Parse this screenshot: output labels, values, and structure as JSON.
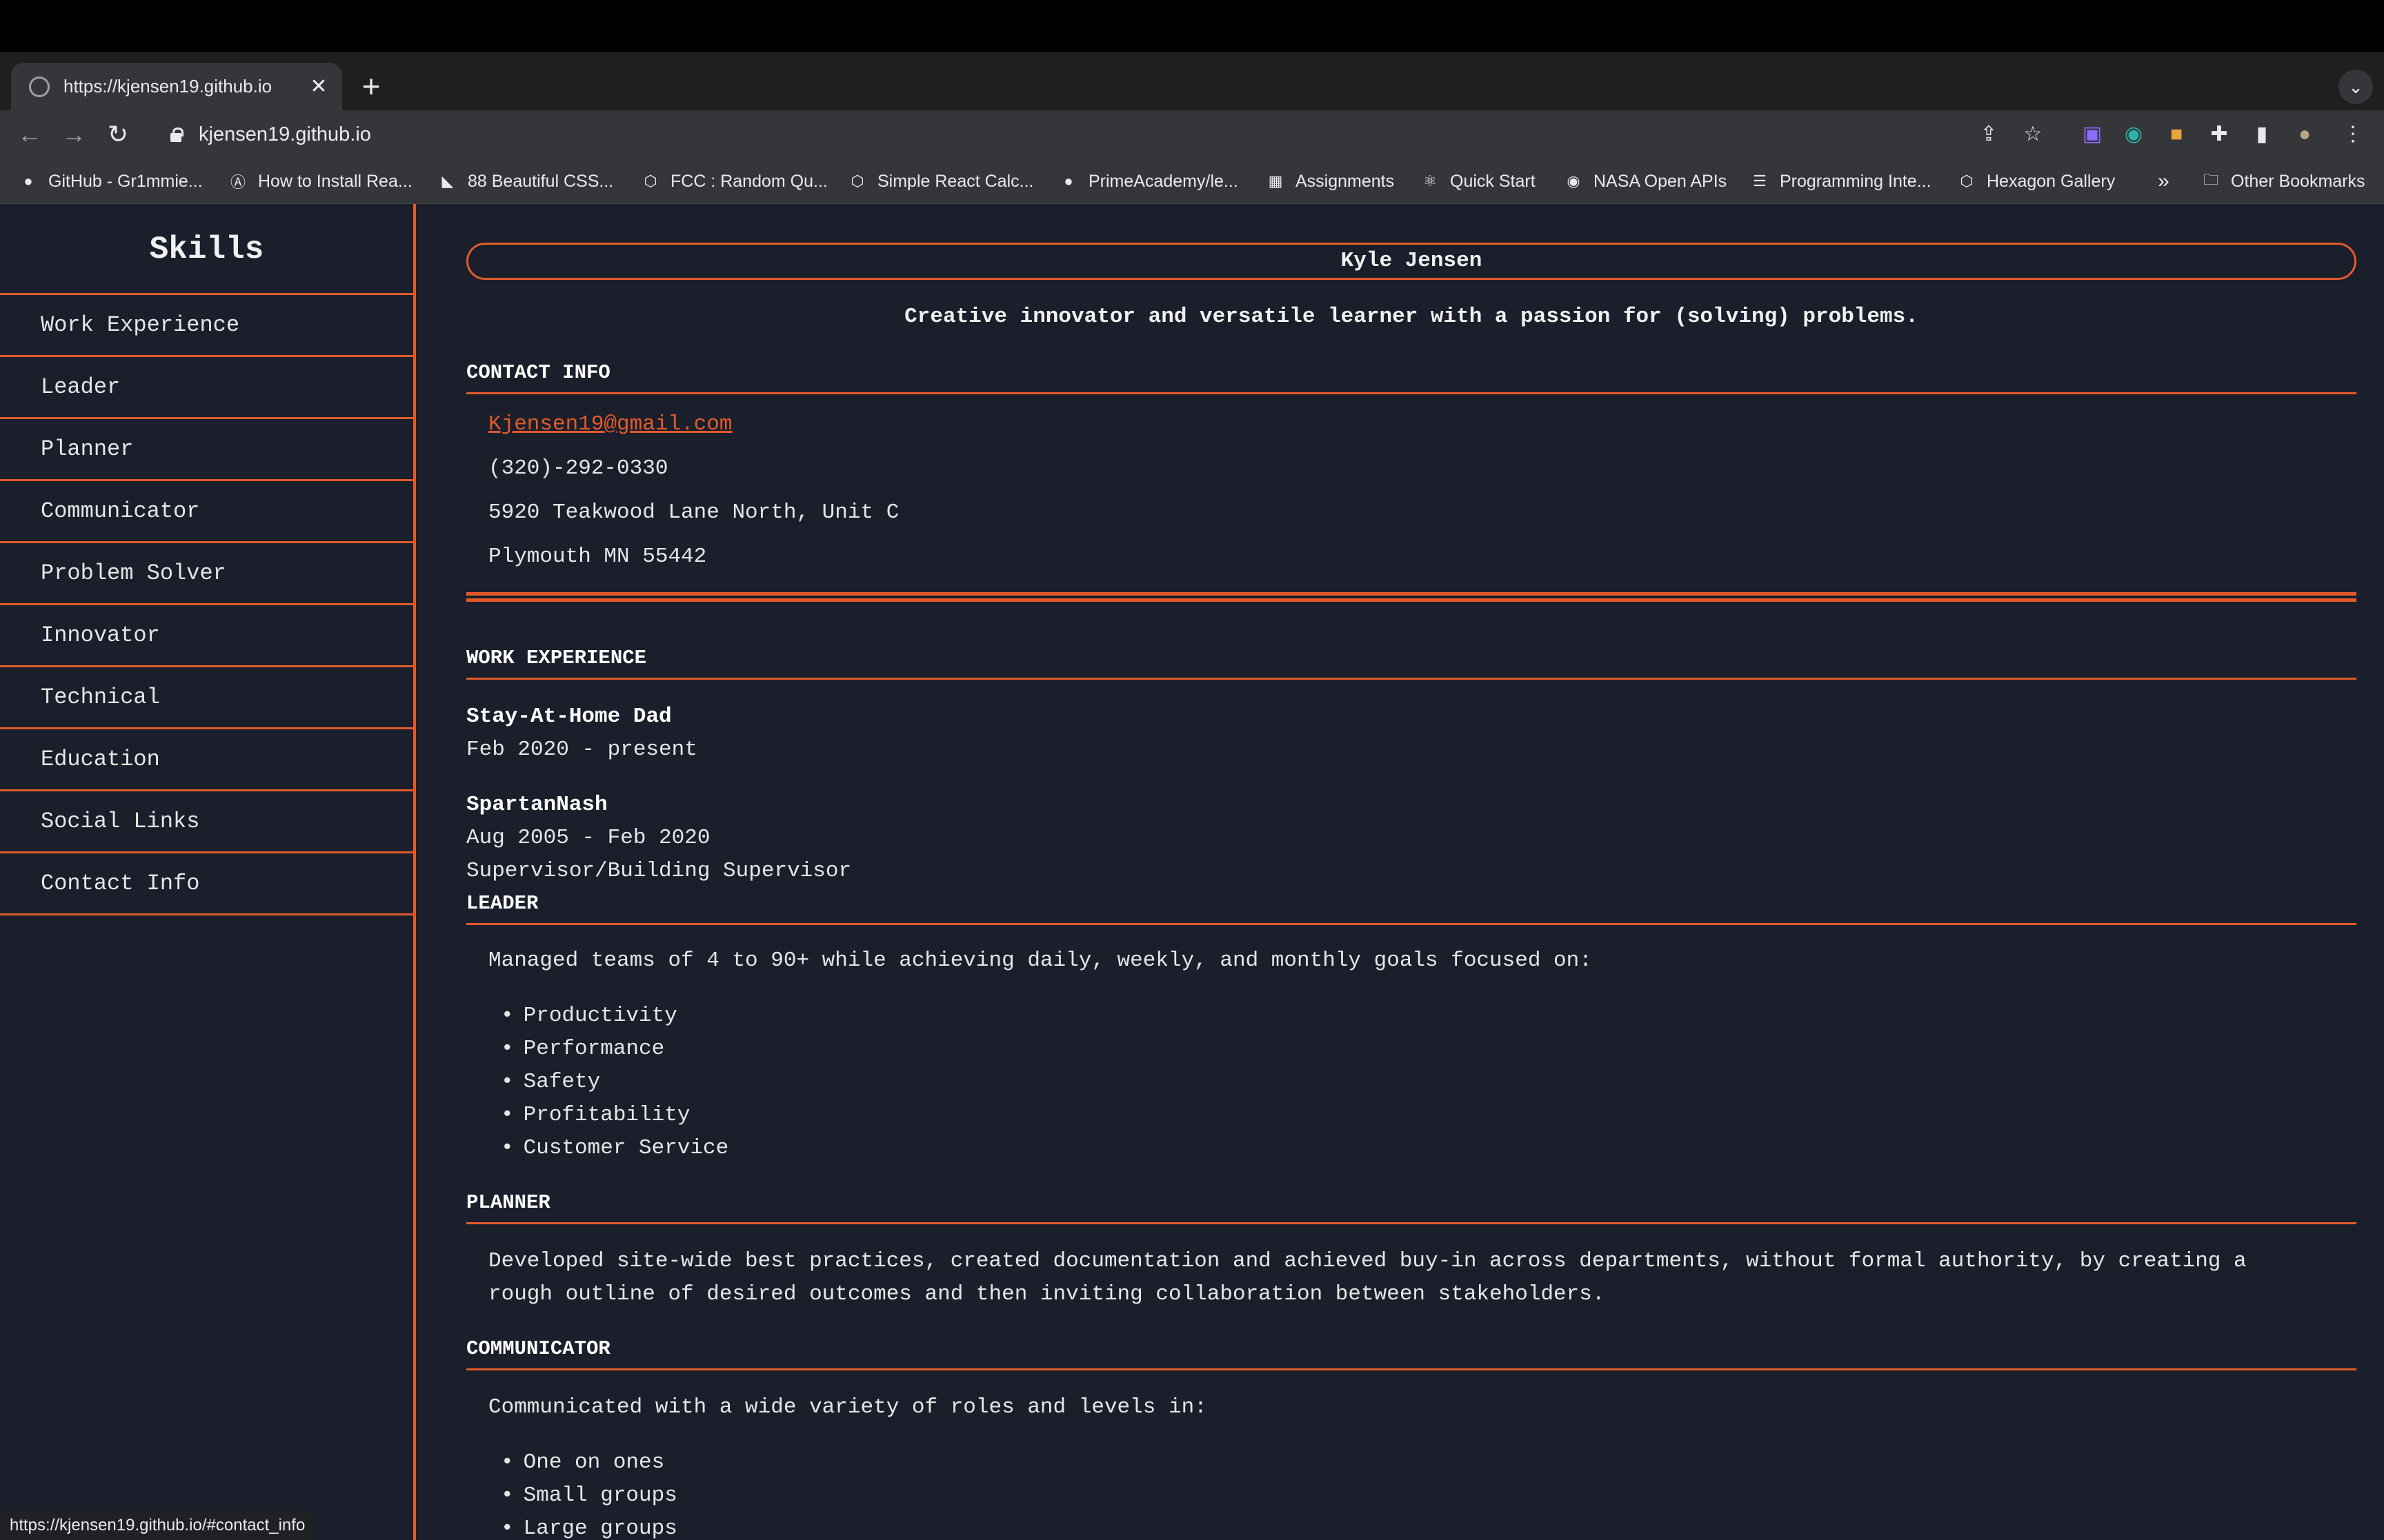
{
  "browser": {
    "tab_title": "https://kjensen19.github.io",
    "tab_close": "✕",
    "new_tab": "+",
    "tab_search": "⌄",
    "address": "kjensen19.github.io",
    "bookmarks": [
      {
        "label": "GitHub - Gr1mmie...",
        "icon": "github-icon",
        "glyph": "●"
      },
      {
        "label": "How to Install Rea...",
        "icon": "a-icon",
        "glyph": "Ⓐ"
      },
      {
        "label": "88 Beautiful CSS...",
        "icon": "css-icon",
        "glyph": "◣"
      },
      {
        "label": "FCC : Random Qu...",
        "icon": "codepen-icon",
        "glyph": "⬡"
      },
      {
        "label": "Simple React Calc...",
        "icon": "codepen-icon",
        "glyph": "⬡"
      },
      {
        "label": "PrimeAcademy/le...",
        "icon": "github-icon",
        "glyph": "●"
      },
      {
        "label": "Assignments",
        "icon": "grid-icon",
        "glyph": "▦"
      },
      {
        "label": "Quick Start",
        "icon": "react-icon",
        "glyph": "⚛"
      },
      {
        "label": "NASA Open APIs",
        "icon": "nasa-icon",
        "glyph": "◉"
      },
      {
        "label": "Programming Inte...",
        "icon": "stack-icon",
        "glyph": "☰"
      },
      {
        "label": "Hexagon Gallery",
        "icon": "codepen-icon",
        "glyph": "⬡"
      }
    ],
    "bookmarks_overflow": "»",
    "other_bookmarks": "Other Bookmarks",
    "status_url": "https://kjensen19.github.io/#contact_info"
  },
  "sidebar": {
    "title": "Skills",
    "items": [
      {
        "label": "Work Experience"
      },
      {
        "label": "Leader"
      },
      {
        "label": "Planner"
      },
      {
        "label": "Communicator"
      },
      {
        "label": "Problem Solver"
      },
      {
        "label": "Innovator"
      },
      {
        "label": "Technical"
      },
      {
        "label": "Education"
      },
      {
        "label": "Social Links"
      },
      {
        "label": "Contact Info"
      }
    ]
  },
  "main": {
    "name": "Kyle Jensen",
    "tagline": "Creative innovator and versatile learner with a passion for (solving) problems.",
    "contact": {
      "heading": "CONTACT INFO",
      "email": "Kjensen19@gmail.com",
      "phone": "(320)-292-0330",
      "address1": "5920 Teakwood Lane North, Unit C",
      "address2": "Plymouth MN 55442"
    },
    "work": {
      "heading": "WORK EXPERIENCE",
      "jobs": [
        {
          "title": "Stay-At-Home Dad",
          "dates": "Feb 2020 - present"
        },
        {
          "title": "SpartanNash",
          "dates": "Aug 2005 - Feb 2020",
          "role": "Supervisor/Building Supervisor"
        }
      ]
    },
    "leader": {
      "heading": "LEADER",
      "intro": "Managed teams of 4 to 90+ while achieving daily, weekly, and monthly goals focused on:",
      "bullets": [
        "Productivity",
        "Performance",
        "Safety",
        "Profitability",
        "Customer Service"
      ]
    },
    "planner": {
      "heading": "PLANNER",
      "line1": "Developed site-wide best practices, created documentation and achieved buy-in across departments, without formal authority, by creating a",
      "line2": "rough outline of desired outcomes and then inviting collaboration between stakeholders."
    },
    "communicator": {
      "heading": "COMMUNICATOR",
      "intro": "Communicated with a wide variety of roles and levels in:",
      "bullets": [
        "One on ones",
        "Small groups",
        "Large groups"
      ]
    }
  }
}
